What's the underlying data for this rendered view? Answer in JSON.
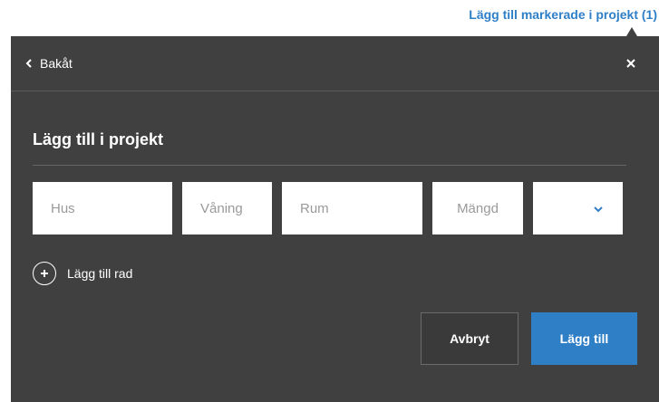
{
  "top_link": {
    "label": "Lägg till markerade i projekt (1)"
  },
  "header": {
    "back_label": "Bakåt"
  },
  "panel": {
    "title": "Lägg till i projekt"
  },
  "fields": {
    "hus_placeholder": "Hus",
    "vaning_placeholder": "Våning",
    "rum_placeholder": "Rum",
    "mangd_placeholder": "Mängd",
    "unit_value": ""
  },
  "add_row": {
    "label": "Lägg till rad"
  },
  "actions": {
    "cancel_label": "Avbryt",
    "add_label": "Lägg till"
  },
  "icons": {
    "back": "chevron-left-icon",
    "close": "close-icon",
    "dropdown": "chevron-down-icon",
    "add": "plus-circle-icon"
  },
  "colors": {
    "accent": "#2f7fc7",
    "panel": "#404040"
  }
}
